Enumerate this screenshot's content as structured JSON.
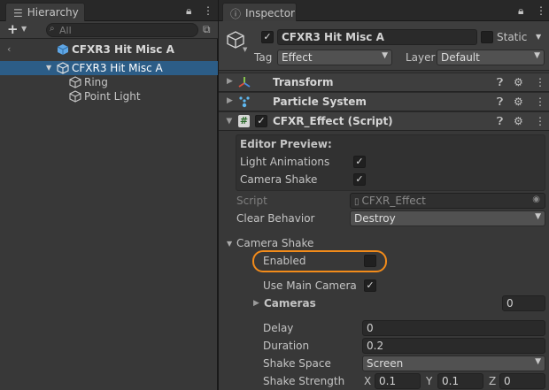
{
  "hierarchy": {
    "tab_label": "Hierarchy",
    "search_placeholder": "All",
    "scene_root": "CFXR3 Hit Misc A",
    "items": [
      {
        "label": "CFXR3 Hit Misc A"
      },
      {
        "label": "Ring"
      },
      {
        "label": "Point Light"
      }
    ]
  },
  "inspector": {
    "tab_label": "Inspector",
    "object": {
      "active": true,
      "name": "CFXR3 Hit Misc A",
      "static_label": "Static",
      "static": false,
      "tag_label": "Tag",
      "tag_value": "Effect",
      "layer_label": "Layer",
      "layer_value": "Default"
    },
    "components": [
      {
        "name": "Transform"
      },
      {
        "name": "Particle System"
      },
      {
        "name": "CFXR_Effect (Script)",
        "enabled": true
      }
    ],
    "script": {
      "editor_preview_title": "Editor Preview:",
      "light_animations_label": "Light Animations",
      "light_animations": true,
      "camera_shake_label": "Camera Shake",
      "camera_shake": true,
      "script_label": "Script",
      "script_value": "CFXR_Effect",
      "clear_behavior_label": "Clear Behavior",
      "clear_behavior_value": "Destroy",
      "camera_shake_section": "Camera Shake",
      "enabled_label": "Enabled",
      "enabled": false,
      "use_main_camera_label": "Use Main Camera",
      "use_main_camera": true,
      "cameras_label": "Cameras",
      "cameras_count": "0",
      "delay_label": "Delay",
      "delay_value": "0",
      "duration_label": "Duration",
      "duration_value": "0.2",
      "shake_space_label": "Shake Space",
      "shake_space_value": "Screen",
      "shake_strength_label": "Shake Strength",
      "x_label": "X",
      "x_value": "0.1",
      "y_label": "Y",
      "y_value": "0.1",
      "z_label": "Z",
      "z_value": "0"
    }
  },
  "colors": {
    "selection": "#2c5d87",
    "highlight_ring": "#f28b1a",
    "prefab_blue": "#5fa6e5"
  }
}
